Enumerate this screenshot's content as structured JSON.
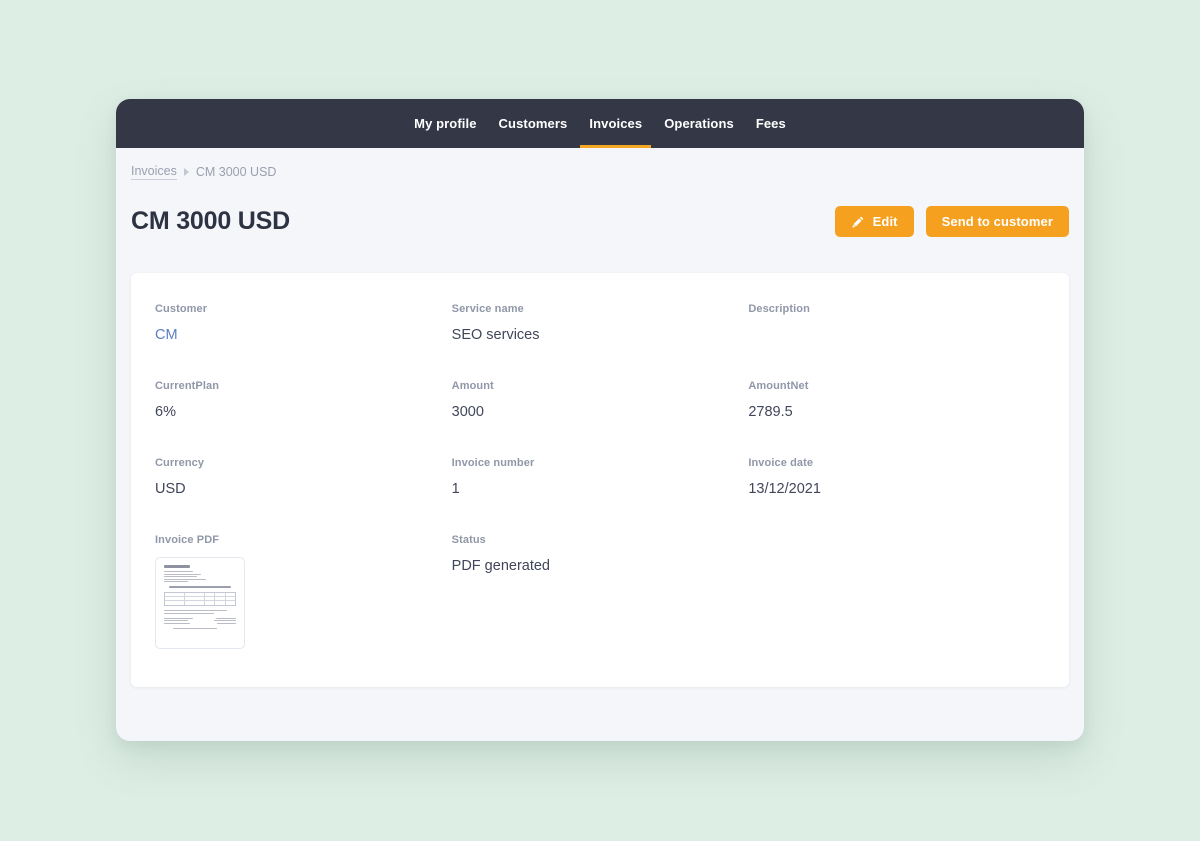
{
  "nav": {
    "items": [
      {
        "label": "My profile",
        "active": false
      },
      {
        "label": "Customers",
        "active": false
      },
      {
        "label": "Invoices",
        "active": true
      },
      {
        "label": "Operations",
        "active": false
      },
      {
        "label": "Fees",
        "active": false
      }
    ]
  },
  "breadcrumb": {
    "parent": "Invoices",
    "separator": "▸",
    "current": "CM 3000 USD"
  },
  "header": {
    "title": "CM 3000 USD",
    "edit_label": "Edit",
    "send_label": "Send to customer"
  },
  "fields": [
    {
      "label": "Customer",
      "value": "CM",
      "type": "link"
    },
    {
      "label": "Service name",
      "value": "SEO services",
      "type": "text"
    },
    {
      "label": "Description",
      "value": "",
      "type": "text"
    },
    {
      "label": "CurrentPlan",
      "value": "6%",
      "type": "text"
    },
    {
      "label": "Amount",
      "value": "3000",
      "type": "text"
    },
    {
      "label": "AmountNet",
      "value": "2789.5",
      "type": "text"
    },
    {
      "label": "Currency",
      "value": "USD",
      "type": "text"
    },
    {
      "label": "Invoice number",
      "value": "1",
      "type": "text"
    },
    {
      "label": "Invoice date",
      "value": "13/12/2021",
      "type": "text"
    }
  ],
  "attachment": {
    "label": "Invoice PDF",
    "thumbnail_name": "invoice-pdf-preview"
  },
  "status": {
    "label": "Status",
    "value": "PDF generated"
  },
  "colors": {
    "page_background": "#ddeee5",
    "navbar": "#343746",
    "accent_orange": "#f5a01e",
    "active_tab_underline": "#f5a623",
    "link_blue": "#5b7ec4",
    "label_gray": "#9097a8",
    "value_slate": "#41465a",
    "card_background": "#ffffff",
    "body_background": "#f4f6f9"
  }
}
